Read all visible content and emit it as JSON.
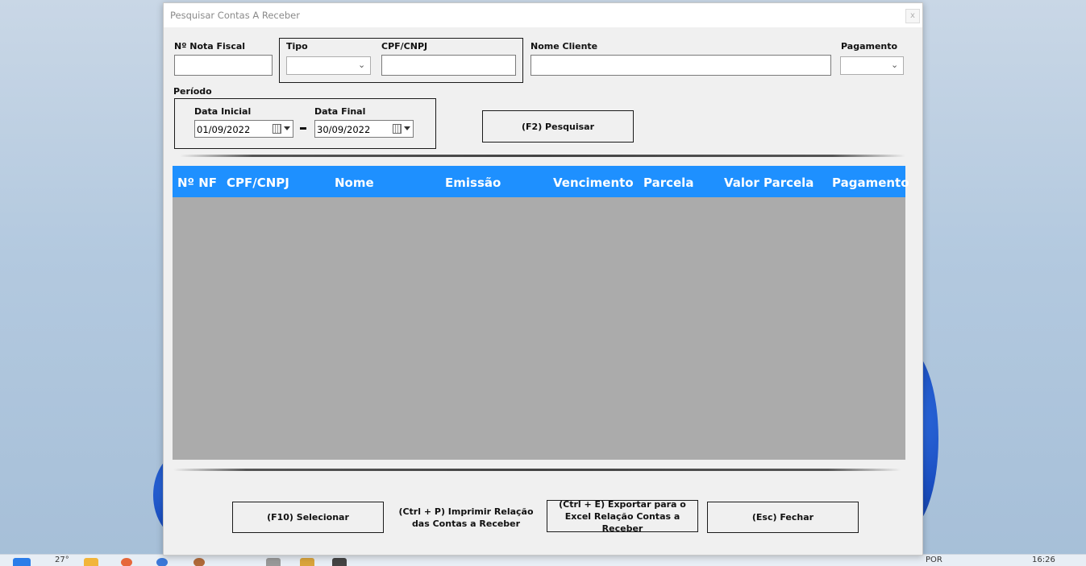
{
  "window": {
    "title": "Pesquisar Contas A Receber",
    "close_label": "x"
  },
  "filters": {
    "nota_fiscal": {
      "label": "Nº Nota Fiscal",
      "value": ""
    },
    "tipo": {
      "label": "Tipo",
      "value": ""
    },
    "cpf_cnpj": {
      "label": "CPF/CNPJ",
      "value": ""
    },
    "nome_cliente": {
      "label": "Nome Cliente",
      "value": ""
    },
    "pagamento": {
      "label": "Pagamento",
      "value": ""
    },
    "periodo": {
      "label": "Período",
      "data_inicial_label": "Data Inicial",
      "data_inicial": "01/09/2022",
      "separator": "-",
      "data_final_label": "Data Final",
      "data_final": "30/09/2022"
    },
    "search_button": "(F2) Pesquisar"
  },
  "grid": {
    "columns": [
      "Nº NF",
      "CPF/CNPJ",
      "Nome",
      "Emissão",
      "Vencimento",
      "Parcela",
      "Valor Parcela",
      "Pagamento"
    ],
    "rows": []
  },
  "footer": {
    "select_button": "(F10) Selecionar",
    "print_button": "(Ctrl + P) Imprimir Relação das Contas a Receber",
    "export_button": "(Ctrl + E) Exportar para o Excel Relação Contas a Receber",
    "close_button": "(Esc) Fechar"
  },
  "taskbar": {
    "weather": "27°",
    "lang": "POR",
    "clock": "16:26"
  }
}
